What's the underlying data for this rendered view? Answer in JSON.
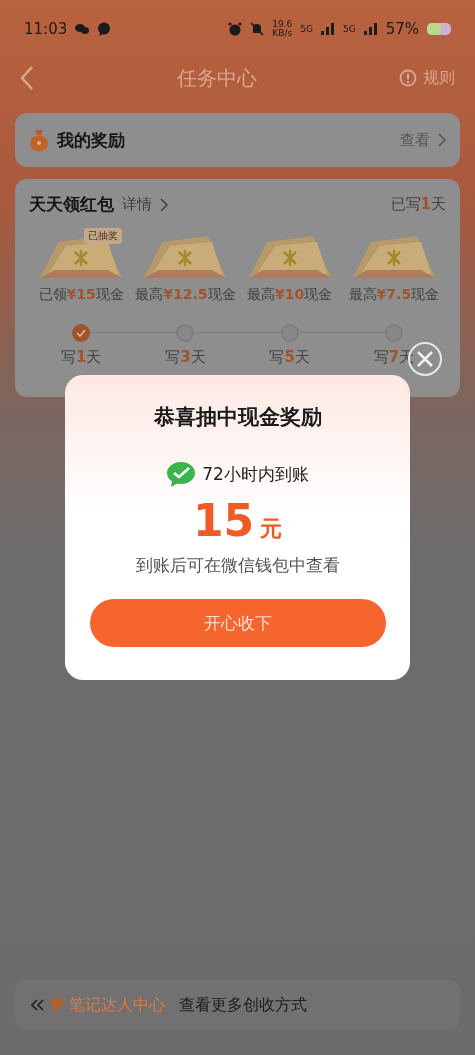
{
  "status_bar": {
    "time": "11:03",
    "net_speed": "19.6",
    "net_unit": "KB/s",
    "sim_1": "5G",
    "sim_2": "5G",
    "battery": "57%"
  },
  "nav": {
    "title": "任务中心",
    "rules": "规则"
  },
  "my_rewards": {
    "title": "我的奖励",
    "action": "查看"
  },
  "daily": {
    "title": "天天领红包",
    "details": "详情",
    "progress_prefix": "已写",
    "progress_value": "1",
    "progress_suffix": "天",
    "rewards": [
      {
        "prefix": "已领",
        "amount": "¥15",
        "suffix": "现金",
        "badge": "已抽奖",
        "step_prefix": "写",
        "step_value": "1",
        "step_suffix": "天",
        "checked": true
      },
      {
        "prefix": "最高",
        "amount": "¥12.5",
        "suffix": "现金",
        "step_prefix": "写",
        "step_value": "3",
        "step_suffix": "天",
        "checked": false
      },
      {
        "prefix": "最高",
        "amount": "¥10",
        "suffix": "现金",
        "step_prefix": "写",
        "step_value": "5",
        "step_suffix": "天",
        "checked": false
      },
      {
        "prefix": "最高",
        "amount": "¥7.5",
        "suffix": "现金",
        "step_prefix": "写",
        "step_value": "7",
        "step_suffix": "天",
        "checked": false
      }
    ]
  },
  "bottom_bar": {
    "link": "笔记达人中心",
    "text": "查看更多创收方式"
  },
  "dialog": {
    "title": "恭喜抽中现金奖励",
    "note": "72小时内到账",
    "amount": "15",
    "unit": "元",
    "hint": "到账后可在微信钱包中查看",
    "button": "开心收下"
  }
}
